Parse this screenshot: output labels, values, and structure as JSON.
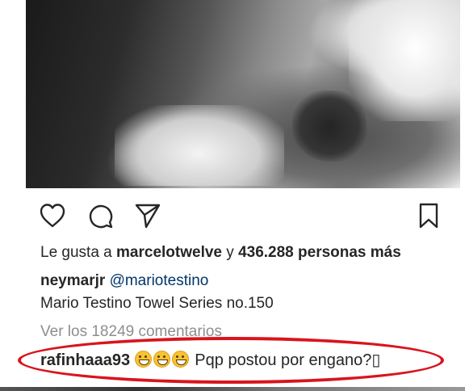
{
  "post": {
    "likes_prefix": "Le gusta a",
    "likes_user": "marcelotwelve",
    "likes_connector": "y",
    "likes_count_text": "436.288 personas más",
    "caption_user": "neymarjr",
    "caption_mention": "@mariotestino",
    "caption_text": "Mario Testino Towel Series no.150",
    "view_comments": "Ver los 18249 comentarios"
  },
  "comment": {
    "user": "rafinhaaa93",
    "emoji": "laughing-tears-emoji",
    "emoji_count": 3,
    "text": "Pqp postou por engano?▯"
  },
  "colors": {
    "highlight_oval": "#d9141c",
    "mention": "#003569",
    "muted": "#8e8e8e"
  },
  "icons": [
    "heart-icon",
    "comment-icon",
    "share-icon",
    "bookmark-icon"
  ]
}
